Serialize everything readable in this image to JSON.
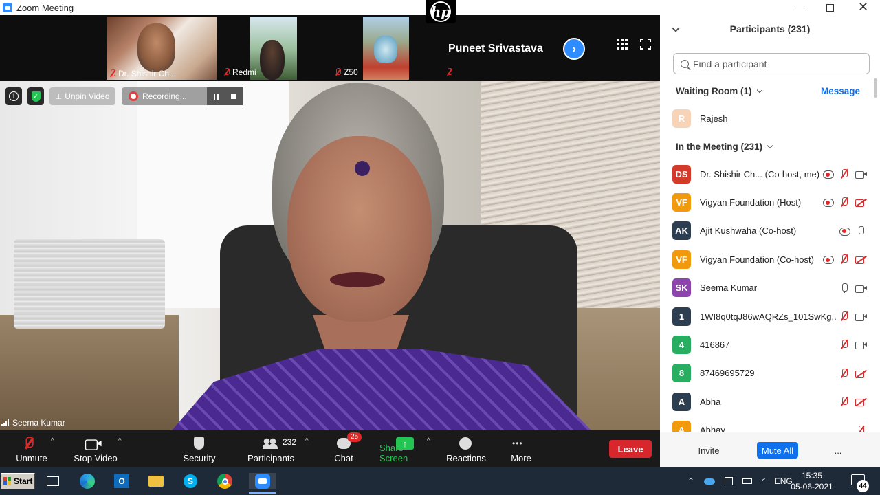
{
  "window": {
    "title": "Zoom Meeting"
  },
  "strip": {
    "thumbnails": [
      {
        "name": "Dr. Shishir Ch..."
      },
      {
        "name": "Redmi"
      },
      {
        "name": "Z50"
      }
    ],
    "text_tile_name": "Puneet Srivastava",
    "next_arrow": "›"
  },
  "video": {
    "overlay": {
      "info": "i",
      "unpin_label": "Unpin Video",
      "recording_label": "Recording..."
    },
    "speaker_name": "Seema Kumar"
  },
  "toolbar": {
    "unmute": "Unmute",
    "stop_video": "Stop Video",
    "security": "Security",
    "participants": "Participants",
    "participants_count": "232",
    "chat": "Chat",
    "chat_badge": "25",
    "share_screen": "Share Screen",
    "reactions": "Reactions",
    "more": "More",
    "more_dots": "•••",
    "leave": "Leave",
    "caret": "^"
  },
  "panel": {
    "title": "Participants (231)",
    "search_placeholder": "Find a participant",
    "waiting_room_label": "Waiting Room (1)",
    "message_label": "Message",
    "waiting": [
      {
        "initial": "R",
        "name": "Rajesh",
        "color": "#f7d4b8"
      }
    ],
    "in_meeting_label": "In the Meeting (231)",
    "participants": [
      {
        "initials": "DS",
        "name": "Dr. Shishir Ch...  (Co-host, me)",
        "color": "#d43a2a",
        "icons": [
          "rec",
          "micoff",
          "cam"
        ]
      },
      {
        "initials": "VF",
        "name": "Vigyan Foundation (Host)",
        "color": "#f29a0e",
        "icons": [
          "rec",
          "micoff",
          "camoff"
        ]
      },
      {
        "initials": "AK",
        "name": "Ajit Kushwaha (Co-host)",
        "color": "#2c3e50",
        "icons": [
          "rec",
          "mic"
        ]
      },
      {
        "initials": "VF",
        "name": "Vigyan Foundation (Co-host)",
        "color": "#f29a0e",
        "icons": [
          "rec",
          "micoff",
          "camoff"
        ]
      },
      {
        "initials": "SK",
        "name": "Seema Kumar",
        "color": "#8e44ad",
        "icons": [
          "mic",
          "cam"
        ]
      },
      {
        "initials": "1",
        "name": "1WI8q0tqJ86wAQRZs_101SwKg...",
        "color": "#2c3e50",
        "icons": [
          "micoff",
          "cam"
        ]
      },
      {
        "initials": "4",
        "name": "416867",
        "color": "#27ae60",
        "icons": [
          "micoff",
          "cam"
        ]
      },
      {
        "initials": "8",
        "name": "87469695729",
        "color": "#27ae60",
        "icons": [
          "micoff",
          "camoff"
        ]
      },
      {
        "initials": "A",
        "name": "Abha",
        "color": "#2c3e50",
        "icons": [
          "micoff",
          "camoff"
        ]
      },
      {
        "initials": "A",
        "name": "Abhay",
        "color": "#f29a0e",
        "icons": [
          "micoff"
        ]
      }
    ],
    "footer": {
      "invite": "Invite",
      "mute_all": "Mute All",
      "more": "..."
    }
  },
  "taskbar": {
    "start_label": "Start",
    "tray_language": "ENG",
    "time": "15:35",
    "date": "05-06-2021",
    "notification_count": "44"
  }
}
